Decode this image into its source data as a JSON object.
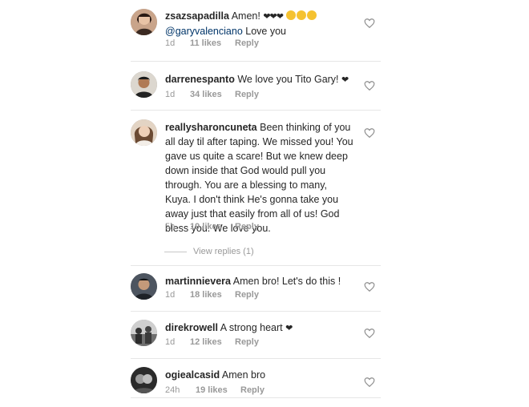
{
  "comments": [
    {
      "username": "zsazsapadilla",
      "text": "Amen! ",
      "emoji_hearts": "❤❤❤",
      "mention": "@garyvalenciano",
      "text2": " Love you",
      "time": "1d",
      "likes": "11 likes",
      "reply": "Reply"
    },
    {
      "username": "darrenespanto",
      "text": " We love you Tito Gary! ",
      "emoji_hearts": "❤",
      "time": "1d",
      "likes": "34 likes",
      "reply": "Reply"
    },
    {
      "username": "reallysharoncuneta",
      "text": " Been thinking of you all day til after taping. We missed you! You gave us quite a scare! But we knew deep down inside that God would pull you through. You are a blessing to many, Kuya. I don't think He's gonna take you away just that easily from all of us! God bless you. We love you.",
      "time": "5h",
      "likes": "19 likes",
      "reply": "Reply",
      "view_replies": "View replies (1)"
    },
    {
      "username": "martinnievera",
      "text": " Amen bro! Let's do this !",
      "time": "1d",
      "likes": "18 likes",
      "reply": "Reply"
    },
    {
      "username": "direkrowell",
      "text": " A strong heart ",
      "emoji_hearts": "❤",
      "time": "1d",
      "likes": "12 likes",
      "reply": "Reply"
    },
    {
      "username": "ogiealcasid",
      "text": " Amen bro",
      "time": "24h",
      "likes": "19 likes",
      "reply": "Reply"
    }
  ],
  "colors": {
    "text": "#262626",
    "muted": "#999999",
    "mention": "#003569",
    "divider": "#e6e6e6"
  }
}
